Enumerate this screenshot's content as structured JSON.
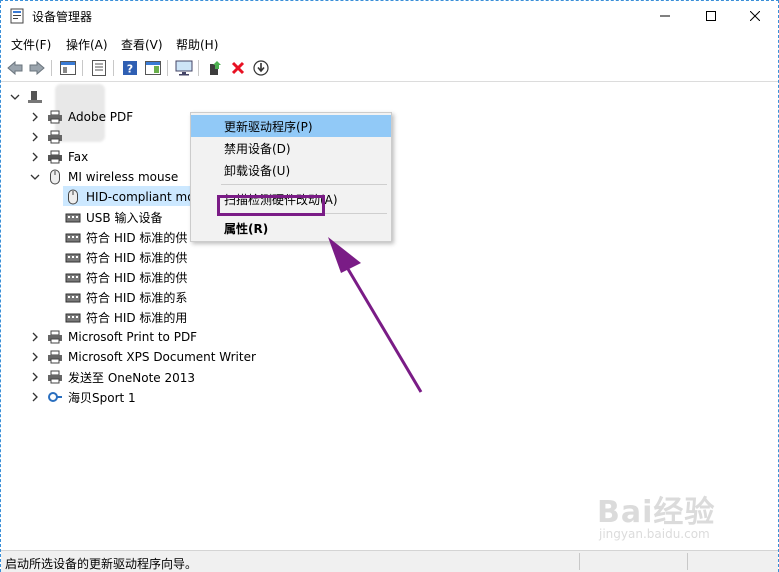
{
  "window": {
    "title": "设备管理器"
  },
  "menubar": {
    "items": [
      "文件(F)",
      "操作(A)",
      "查看(V)",
      "帮助(H)"
    ]
  },
  "tree": {
    "root": "          ",
    "items": [
      {
        "label": "Adobe PDF",
        "icon": "printer-icon",
        "expanded": false
      },
      {
        "label": "",
        "icon": "printer-icon",
        "expanded": false
      },
      {
        "label": "Fax",
        "icon": "fax-icon",
        "expanded": false
      },
      {
        "label": "MI wireless mouse",
        "icon": "mouse-icon",
        "expanded": true,
        "children": [
          {
            "label": "HID-compliant mo",
            "icon": "mouse-icon"
          },
          {
            "label": "USB 输入设备",
            "icon": "hid-icon"
          },
          {
            "label": "符合 HID 标准的供",
            "icon": "hid-icon"
          },
          {
            "label": "符合 HID 标准的供",
            "icon": "hid-icon"
          },
          {
            "label": "符合 HID 标准的供",
            "icon": "hid-icon"
          },
          {
            "label": "符合 HID 标准的系",
            "icon": "hid-icon"
          },
          {
            "label": "符合 HID 标准的用",
            "icon": "hid-icon"
          }
        ]
      },
      {
        "label": "Microsoft Print to PDF",
        "icon": "printer-icon",
        "expanded": false
      },
      {
        "label": "Microsoft XPS Document Writer",
        "icon": "printer-icon",
        "expanded": false
      },
      {
        "label": "发送至 OneNote 2013",
        "icon": "printer-icon",
        "expanded": false
      },
      {
        "label": "海贝Sport 1",
        "icon": "headset-icon",
        "expanded": false
      }
    ]
  },
  "context_menu": {
    "items": [
      {
        "label": "更新驱动程序(P)"
      },
      {
        "label": "禁用设备(D)"
      },
      {
        "label": "卸载设备(U)"
      },
      {
        "label": "扫描检测硬件改动(A)"
      },
      {
        "label": "属性(R)"
      }
    ]
  },
  "statusbar": {
    "text": "启动所选设备的更新驱动程序向导。"
  },
  "watermark": {
    "brand": "Bai经验",
    "sub": "jingyan.baidu.com"
  },
  "colors": {
    "accent": "#7a1c86",
    "highlight": "#91c9f7",
    "selection": "#cce8ff",
    "delete": "#e81123"
  }
}
